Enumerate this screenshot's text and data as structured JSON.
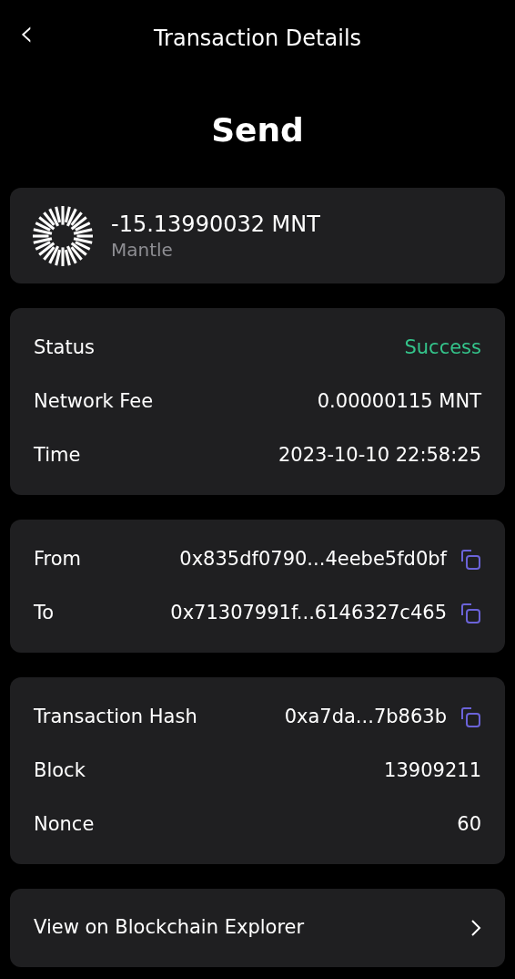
{
  "header": {
    "back_icon": "‹",
    "title": "Transaction Details"
  },
  "type_label": "Send",
  "asset": {
    "amount": "-15.13990032 MNT",
    "name": "Mantle"
  },
  "sections": [
    {
      "rows": [
        {
          "label": "Status",
          "value": "Success",
          "kind": "status"
        },
        {
          "label": "Network Fee",
          "value": "0.00000115 MNT",
          "kind": "text"
        },
        {
          "label": "Time",
          "value": "2023-10-10 22:58:25",
          "kind": "text"
        }
      ]
    },
    {
      "rows": [
        {
          "label": "From",
          "value": "0x835df0790...4eebe5fd0bf",
          "kind": "copy"
        },
        {
          "label": "To",
          "value": "0x71307991f...6146327c465",
          "kind": "copy"
        }
      ]
    },
    {
      "rows": [
        {
          "label": "Transaction Hash",
          "value": "0xa7da...7b863b",
          "kind": "copy"
        },
        {
          "label": "Block",
          "value": "13909211",
          "kind": "text"
        },
        {
          "label": "Nonce",
          "value": "60",
          "kind": "text"
        }
      ]
    }
  ],
  "explorer_link": {
    "label": "View on Blockchain Explorer"
  }
}
